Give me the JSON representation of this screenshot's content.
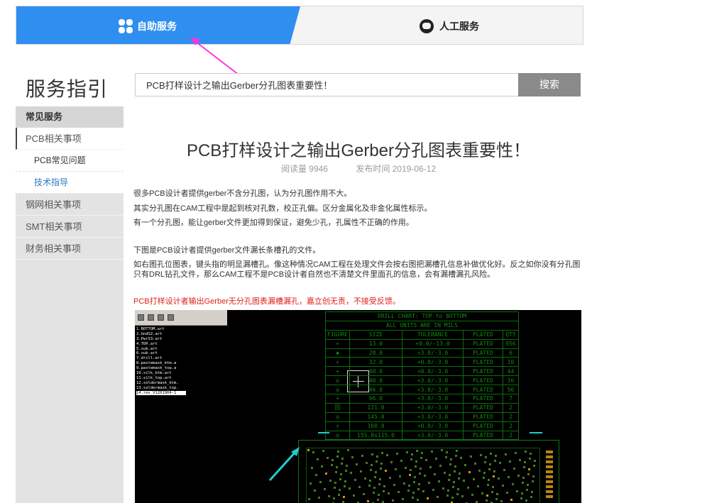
{
  "tabs": {
    "self_service": "自助服务",
    "human_service": "人工服务"
  },
  "sidebar": {
    "title": "服务指引",
    "section": "常见服务",
    "items": [
      {
        "label": "PCB相关事项"
      },
      {
        "label": "PCB常见问题"
      },
      {
        "label": "技术指导"
      },
      {
        "label": "钢网相关事项"
      },
      {
        "label": "SMT相关事项"
      },
      {
        "label": "财务相关事项"
      }
    ]
  },
  "search": {
    "value": "PCB打样设计之输出Gerber分孔图表重要性！",
    "button": "搜索"
  },
  "article": {
    "title": "PCB打样设计之输出Gerber分孔图表重要性！",
    "read_count": "阅读量 9946",
    "publish_time": "发布时间 2019-06-12",
    "paragraphs": [
      "很多PCB设计者提供gerber不含分孔图，认为分孔图作用不大。",
      "其实分孔图在CAM工程中是起到核对孔数，校正孔偏。区分金属化及非金化属性标示。",
      "有一个分孔图，能让gerber文件更加得到保证，避免少孔，孔属性不正确的作用。",
      "下图是PCB设计者提供gerber文件漏长条槽孔的文件。",
      "如右图孔位图表，键头指的明显漏槽孔。像这种情况CAM工程在处理文件会按右图把漏槽孔信息补做优化好。反之如你没有分孔图只有DRL钻孔文件，那么CAM工程不是PCB设计者自然也不清楚文件里面孔的信息，会有漏槽漏孔风险。",
      "PCB打样设计者输出Gerber无分孔图表漏槽漏孔，嘉立创无责，不接受反馈。"
    ]
  },
  "screenshot": {
    "layers": [
      "1.BOTTOM.art",
      "2.GndS2.art",
      "3.PwrS3.art",
      "4.TOP.art",
      "5.sub.art",
      "6.sub.art",
      "7.drill.art",
      "8.pastemask_btm.a",
      "9.pastemask_top.a",
      "10.silk_btm.art",
      "11.silk_top.art",
      "12.soldermask_btm.",
      "13.soldermask_top.",
      "14.rev_V1201904-1"
    ],
    "drill_title": "DRILL CHART: TOP to BOTTOM",
    "drill_subtitle": "ALL UNITS ARE IN MILS",
    "drill_headers": [
      "FIGURE",
      "SIZE",
      "TOLERANCE",
      "PLATED",
      "QTY"
    ],
    "drill_rows": [
      [
        "+",
        "13.0",
        "+0.0/-13.0",
        "PLATED",
        "956"
      ],
      [
        "◆",
        "28.0",
        "+3.0/-3.0",
        "PLATED",
        "6"
      ],
      [
        "+",
        "32.0",
        "+0.0/-3.0",
        "PLATED",
        "10"
      ],
      [
        "+",
        "40.0",
        "+0.0/-3.0",
        "PLATED",
        "44"
      ],
      [
        "◎",
        "40.0",
        "+3.0/-3.0",
        "PLATED",
        "16"
      ],
      [
        "◎",
        "46.0",
        "+3.0/-3.0",
        "PLATED",
        "56"
      ],
      [
        "+",
        "66.0",
        "+3.0/-3.0",
        "PLATED",
        "7"
      ],
      [
        "回",
        "131.0",
        "+3.0/-3.0",
        "PLATED",
        "2"
      ],
      [
        "◎",
        "145.0",
        "+3.0/-3.0",
        "PLATED",
        "2"
      ],
      [
        "+",
        "160.0",
        "+0.0/-3.0",
        "PLATED",
        "2"
      ],
      [
        "◎",
        "155.0x115.0",
        "+3.0/-3.0",
        "PLATED",
        "2"
      ]
    ]
  }
}
